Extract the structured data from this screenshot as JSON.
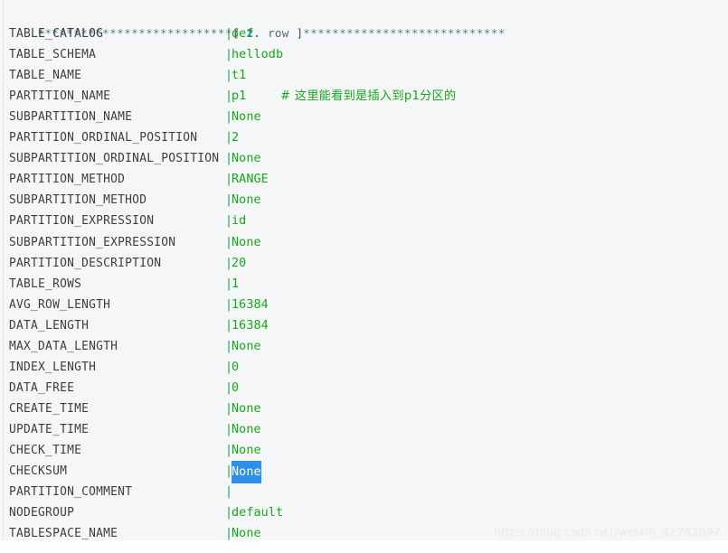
{
  "terminal": {
    "background_color": "#f5f6f8",
    "label_color": "#3e3e3e",
    "value_color": "#17a81a",
    "separator_color": "#1aa64b",
    "selection_bg_color": "#2e8fe8",
    "selection_fg_color": "#ffffff",
    "header_color": "#4f7a86"
  },
  "record_header": {
    "stars_left": "***************************",
    "bracket_open": "[",
    "row_number": "2.",
    "row_word": "row",
    "bracket_close": "]",
    "stars_right": "****************************",
    "full_text": "***************************[ 2. row ]****************************"
  },
  "separator": "|",
  "fields": [
    {
      "name": "TABLE_CATALOG",
      "value": "def"
    },
    {
      "name": "TABLE_SCHEMA",
      "value": "hellodb"
    },
    {
      "name": "TABLE_NAME",
      "value": "t1"
    },
    {
      "name": "PARTITION_NAME",
      "value": "p1",
      "comment": "# 这里能看到是插入到p1分区的"
    },
    {
      "name": "SUBPARTITION_NAME",
      "value": "None"
    },
    {
      "name": "PARTITION_ORDINAL_POSITION",
      "value": "2"
    },
    {
      "name": "SUBPARTITION_ORDINAL_POSITION",
      "value": "None"
    },
    {
      "name": "PARTITION_METHOD",
      "value": "RANGE"
    },
    {
      "name": "SUBPARTITION_METHOD",
      "value": "None"
    },
    {
      "name": "PARTITION_EXPRESSION",
      "value": "id"
    },
    {
      "name": "SUBPARTITION_EXPRESSION",
      "value": "None"
    },
    {
      "name": "PARTITION_DESCRIPTION",
      "value": "20"
    },
    {
      "name": "TABLE_ROWS",
      "value": "1"
    },
    {
      "name": "AVG_ROW_LENGTH",
      "value": "16384"
    },
    {
      "name": "DATA_LENGTH",
      "value": "16384"
    },
    {
      "name": "MAX_DATA_LENGTH",
      "value": "None"
    },
    {
      "name": "INDEX_LENGTH",
      "value": "0"
    },
    {
      "name": "DATA_FREE",
      "value": "0"
    },
    {
      "name": "CREATE_TIME",
      "value": "None"
    },
    {
      "name": "UPDATE_TIME",
      "value": "None"
    },
    {
      "name": "CHECK_TIME",
      "value": "None"
    },
    {
      "name": "CHECKSUM",
      "value": "None",
      "selected": true
    },
    {
      "name": "PARTITION_COMMENT",
      "value": ""
    },
    {
      "name": "NODEGROUP",
      "value": "default"
    },
    {
      "name": "TABLESPACE_NAME",
      "value": "None"
    }
  ],
  "watermark": {
    "text": "https://blog.csdn.net/weixin_42782897"
  }
}
